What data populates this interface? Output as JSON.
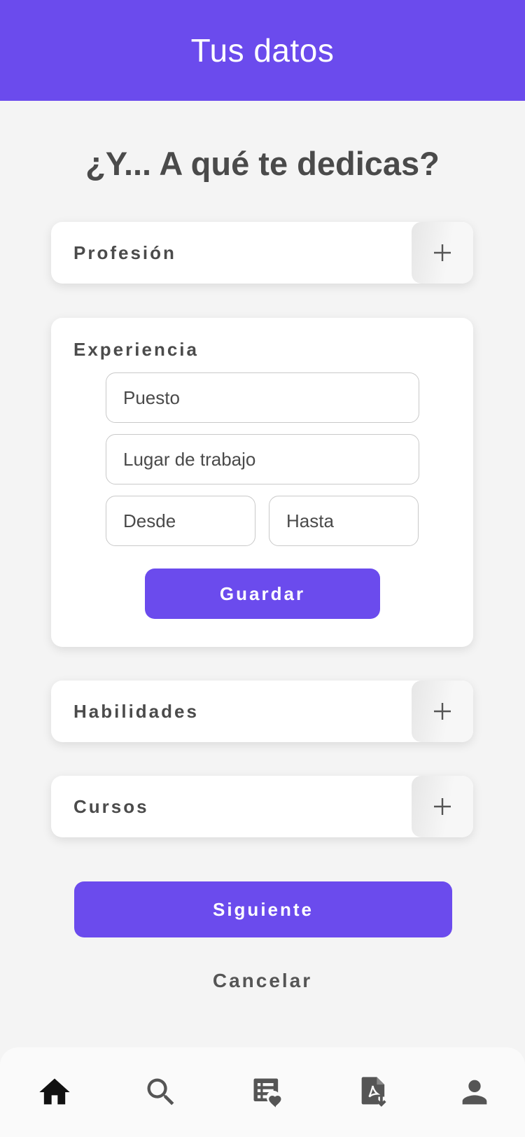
{
  "appbar": {
    "title": "Tus datos"
  },
  "question": "¿Y... A qué te dedicas?",
  "sections": {
    "profesion": {
      "label": "Profesión",
      "icon": "plus-icon"
    },
    "experiencia": {
      "label": "Experiencia",
      "fields": {
        "puesto": "Puesto",
        "lugar": "Lugar de trabajo",
        "desde": "Desde",
        "hasta": "Hasta"
      },
      "save_label": "Guardar"
    },
    "habilidades": {
      "label": "Habilidades",
      "icon": "plus-icon"
    },
    "cursos": {
      "label": "Cursos",
      "icon": "plus-icon"
    }
  },
  "actions": {
    "next_label": "Siguiente",
    "cancel_label": "Cancelar"
  },
  "nav": {
    "items": [
      "home-icon",
      "search-icon",
      "favorites-list-icon",
      "pdf-download-icon",
      "profile-icon"
    ],
    "active": "home-icon"
  },
  "colors": {
    "accent": "#6b4bed",
    "background": "#f4f4f4",
    "text": "#4a4a4a"
  }
}
